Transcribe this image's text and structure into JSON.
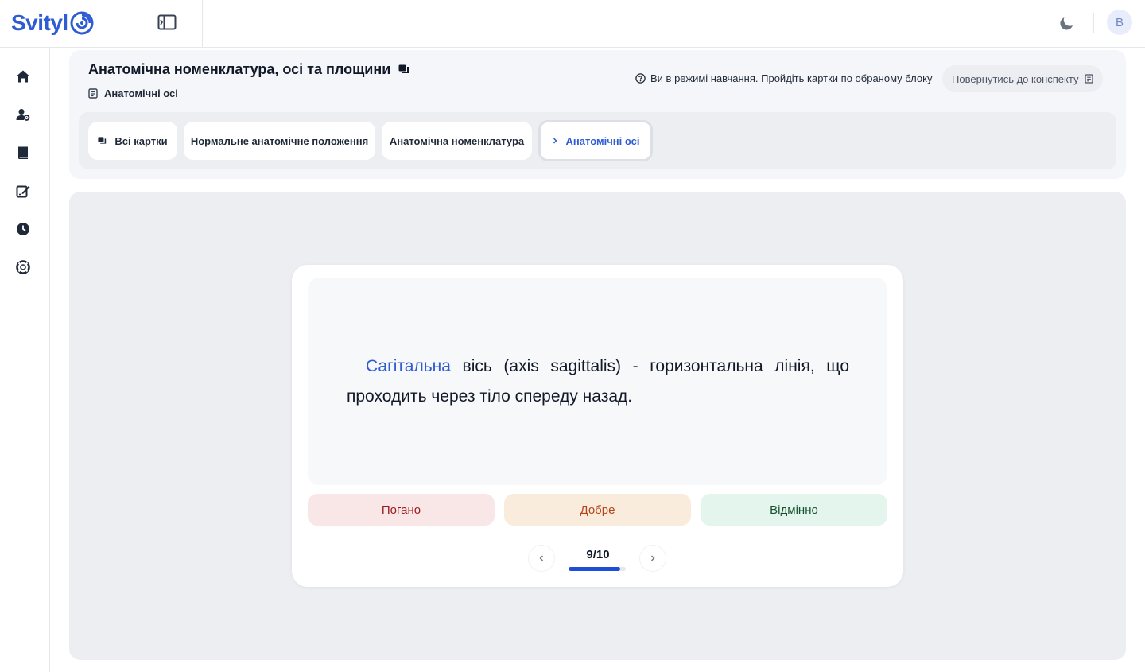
{
  "app": {
    "logo_text": "Svityl"
  },
  "user": {
    "avatar_initial": "B"
  },
  "header": {
    "title": "Анатомічна номенклатура, осі та площини",
    "subtitle": "Анатомічні осі",
    "mode_info": "Ви в режимі навчання. Пройдіть картки по обраному блоку",
    "back_label": "Повернутись до конспекту"
  },
  "tabs": [
    {
      "label": "Всі картки",
      "icon": "cards-icon",
      "active": false
    },
    {
      "label": "Нормальне анатомічне положення",
      "active": false
    },
    {
      "label": "Анатомічна номенклатура",
      "active": false
    },
    {
      "label": "Анатомічні осі",
      "icon": "chevron-right-icon",
      "active": true
    }
  ],
  "sidebar": {
    "items": [
      "home-icon",
      "user-settings-icon",
      "book-icon",
      "edit-icon",
      "clock-icon",
      "support-icon"
    ]
  },
  "card": {
    "highlight": "Сагітальна",
    "text": " вісь (axis sagittalis) - горизонтальна лінія, що проходить через тіло спереду назад."
  },
  "ratings": {
    "bad": "Погано",
    "good": "Добре",
    "great": "Відмінно"
  },
  "pager": {
    "counter": "9/10",
    "progress": 0.9
  },
  "colors": {
    "accent": "#2f5bd3",
    "progress": "#1d4ed8"
  }
}
